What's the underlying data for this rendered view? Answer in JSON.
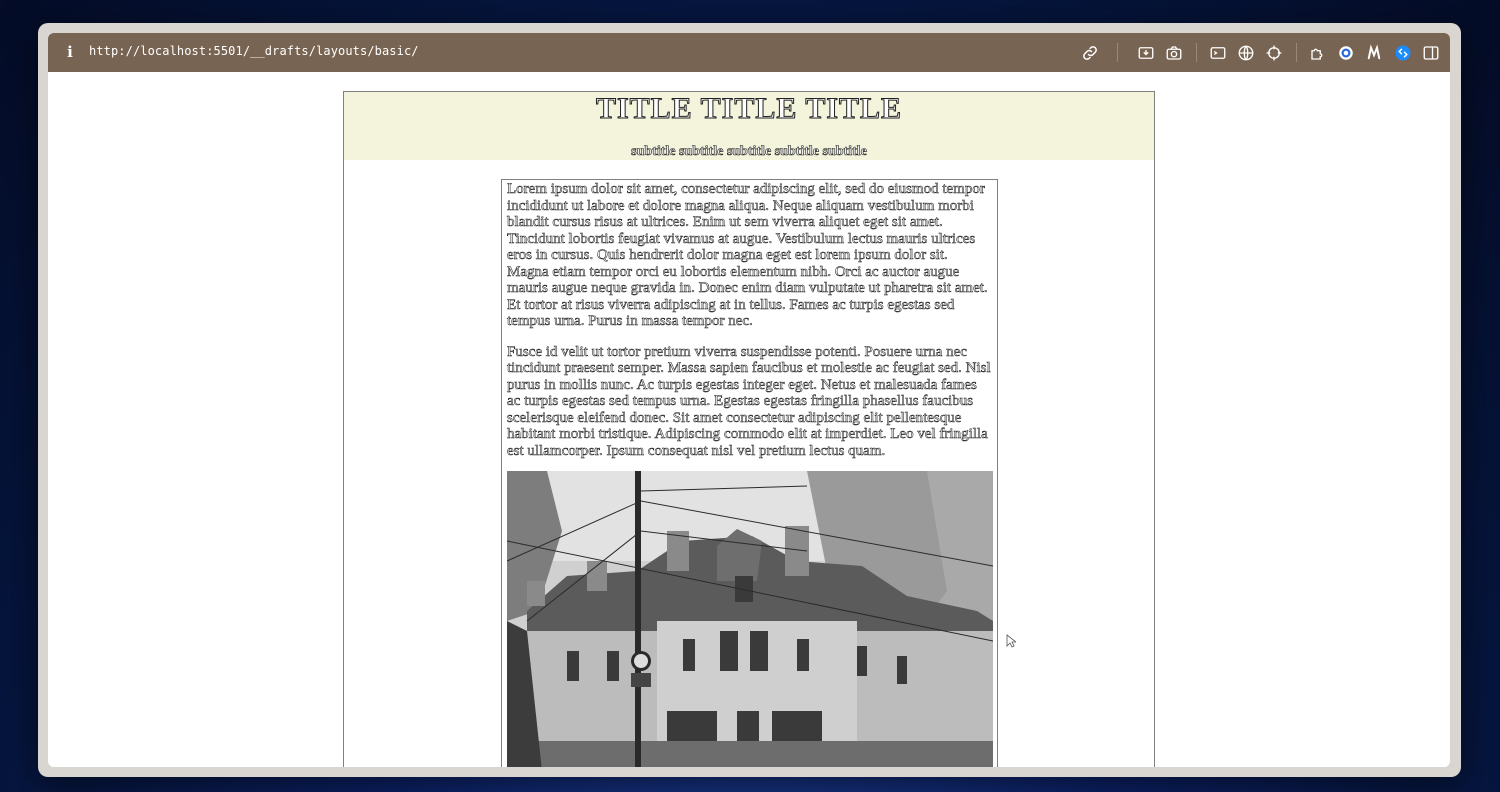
{
  "browser": {
    "url": "http://localhost:5501/__drafts/layouts/basic/",
    "info_icon": "i",
    "toolbar_icons": [
      "link-icon",
      "download-icon",
      "camera-icon",
      "terminal-icon",
      "globe-icon",
      "crosshair-icon",
      "extension-icon",
      "badge-icon",
      "m-icon",
      "shazam-icon",
      "sidebar-icon"
    ]
  },
  "page": {
    "title": "TITLE TITLE TITLE",
    "subtitle": "subtitle subtitle subtitle subtitle subtitle",
    "paragraphs": [
      "Lorem ipsum dolor sit amet, consectetur adipiscing elit, sed do eiusmod tempor incididunt ut labore et dolore magna aliqua. Neque aliquam vestibulum morbi blandit cursus risus at ultrices. Enim ut sem viverra aliquet eget sit amet. Tincidunt lobortis feugiat vivamus at augue. Vestibulum lectus mauris ultrices eros in cursus. Quis hendrerit dolor magna eget est lorem ipsum dolor sit. Magna etiam tempor orci eu lobortis elementum nibh. Orci ac auctor augue mauris augue neque gravida in. Donec enim diam vulputate ut pharetra sit amet. Et tortor at risus viverra adipiscing at in tellus. Fames ac turpis egestas sed tempus urna. Purus in massa tempor nec.",
      "Fusce id velit ut tortor pretium viverra suspendisse potenti. Posuere urna nec tincidunt praesent semper. Massa sapien faucibus et molestie ac feugiat sed. Nisl purus in mollis nunc. Ac turpis egestas integer eget. Netus et malesuada fames ac turpis egestas sed tempus urna. Egestas egestas fringilla phasellus faucibus scelerisque eleifend donec. Sit amet consectetur adipiscing elit pellentesque habitant morbi tristique. Adipiscing commodo elit at imperdiet. Leo vel fringilla est ullamcorper. Ipsum consequat nisl vel pretium lectus quam."
    ],
    "header_bg": "#f4f3dc",
    "toolbar_bg": "#786452"
  }
}
